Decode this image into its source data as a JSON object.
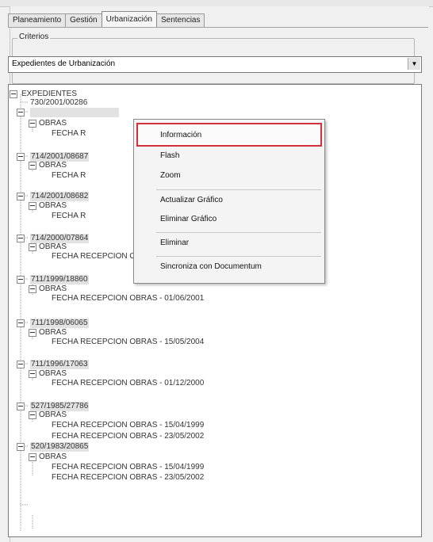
{
  "tabs": [
    "Planeamiento",
    "Gestión",
    "Urbanización",
    "Sentencias"
  ],
  "active_tab_index": 2,
  "criteria": {
    "legend": "Criterios",
    "selected": "Expedientes de Urbanización"
  },
  "tree": {
    "root": "EXPEDIENTES",
    "lines": [
      "730/2001/00286",
      "",
      "OBRAS",
      "FECHA R",
      "714/2001/08687",
      "OBRAS",
      "FECHA R",
      "714/2001/08682",
      "OBRAS",
      "FECHA R",
      "714/2000/07864",
      "OBRAS",
      "FECHA RECEPCION OBRAS - 04/07/2002",
      "711/1999/18860",
      "OBRAS",
      "FECHA RECEPCION OBRAS - 01/06/2001",
      "711/1998/06065",
      "OBRAS",
      "FECHA RECEPCION OBRAS - 15/05/2004",
      "711/1996/17063",
      "OBRAS",
      "FECHA RECEPCION OBRAS - 01/12/2000",
      "527/1985/27786",
      "OBRAS",
      "FECHA RECEPCION OBRAS - 15/04/1999",
      "FECHA RECEPCION OBRAS - 23/05/2002",
      "520/1983/20865",
      "OBRAS",
      "FECHA RECEPCION OBRAS - 15/04/1999",
      "FECHA RECEPCION OBRAS - 23/05/2002"
    ]
  },
  "context_menu": {
    "items": [
      "Información",
      "Flash",
      "Zoom",
      "Actualizar Gráfico",
      "Eliminar Gráfico",
      "Eliminar",
      "Sincroniza con Documentum"
    ],
    "highlighted_index": 0,
    "highlight_color": "#d32f3c"
  }
}
